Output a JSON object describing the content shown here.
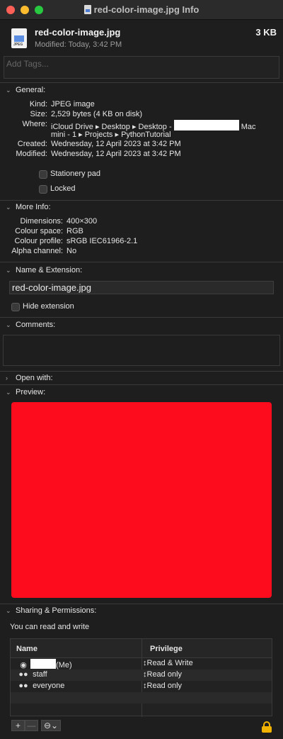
{
  "window": {
    "title": "red-color-image.jpg Info"
  },
  "file": {
    "name": "red-color-image.jpg",
    "size": "3 KB",
    "modified_label": "Modified:",
    "modified_value": "Today, 3:42 PM",
    "icon_text": "JPEG"
  },
  "tags": {
    "placeholder": "Add Tags..."
  },
  "general": {
    "header": "General:",
    "kind_label": "Kind:",
    "kind_value": "JPEG image",
    "size_label": "Size:",
    "size_value": "2,529 bytes (4 KB on disk)",
    "where_label": "Where:",
    "where_value_1a": "iCloud Drive ▸ Desktop ▸ Desktop -",
    "where_value_1b": "Mac",
    "where_value_2": "mini - 1 ▸ Projects ▸ PythonTutorial",
    "created_label": "Created:",
    "created_value": "Wednesday, 12 April 2023 at 3:42 PM",
    "modified_label": "Modified:",
    "modified_value": "Wednesday, 12 April 2023 at 3:42 PM",
    "stationery_label": "Stationery pad",
    "locked_label": "Locked"
  },
  "more_info": {
    "header": "More Info:",
    "dimensions_label": "Dimensions:",
    "dimensions_value": "400×300",
    "colour_space_label": "Colour space:",
    "colour_space_value": "RGB",
    "colour_profile_label": "Colour profile:",
    "colour_profile_value": "sRGB IEC61966-2.1",
    "alpha_label": "Alpha channel:",
    "alpha_value": "No"
  },
  "name_extension": {
    "header": "Name & Extension:",
    "value": "red-color-image.jpg",
    "hide_extension_label": "Hide extension"
  },
  "comments": {
    "header": "Comments:"
  },
  "open_with": {
    "header": "Open with:"
  },
  "preview": {
    "header": "Preview:",
    "color": "#fc0c1d"
  },
  "sharing": {
    "header": "Sharing & Permissions:",
    "summary": "You can read and write",
    "col_name": "Name",
    "col_privilege": "Privilege",
    "rows": [
      {
        "user": "(Me)",
        "privilege": "Read & Write"
      },
      {
        "user": "staff",
        "privilege": "Read only"
      },
      {
        "user": "everyone",
        "privilege": "Read only"
      }
    ],
    "add_label": "+",
    "remove_label": "—",
    "action_label": "⊖⌄"
  },
  "colors": {
    "background": "#1e1e1e",
    "lock": "#f2b300"
  }
}
